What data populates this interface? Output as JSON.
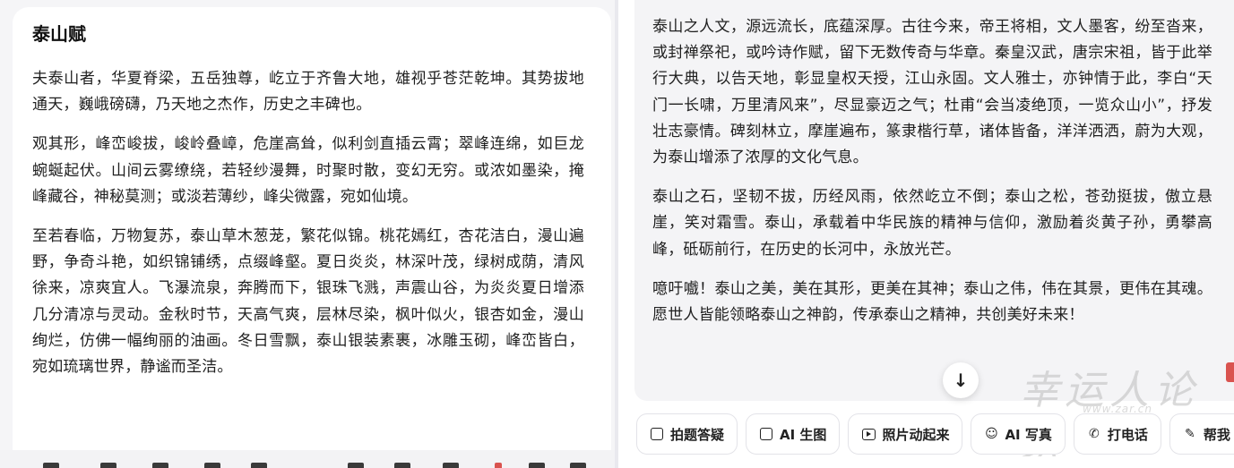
{
  "left": {
    "title": "泰山赋",
    "paragraphs": [
      "夫泰山者，华夏脊梁，五岳独尊，屹立于齐鲁大地，雄视乎苍茫乾坤。其势拔地通天，巍峨磅礴，乃天地之杰作，历史之丰碑也。",
      "观其形，峰峦峻拔，峻岭叠嶂，危崖高耸，似利剑直插云霄；翠峰连绵，如巨龙蜿蜒起伏。山间云雾缭绕，若轻纱漫舞，时聚时散，变幻无穷。或浓如墨染，掩峰藏谷，神秘莫测；或淡若薄纱，峰尖微露，宛如仙境。",
      "至若春临，万物复苏，泰山草木葱茏，繁花似锦。桃花嫣红，杏花洁白，漫山遍野，争奇斗艳，如织锦铺绣，点缀峰壑。夏日炎炎，林深叶茂，绿树成荫，清风徐来，凉爽宜人。飞瀑流泉，奔腾而下，银珠飞溅，声震山谷，为炎炎夏日增添几分清凉与灵动。金秋时节，天高气爽，层林尽染，枫叶似火，银杏如金，漫山绚烂，仿佛一幅绚丽的油画。冬日雪飘，泰山银装素裹，冰雕玉砌，峰峦皆白，宛如琉璃世界，静谧而圣洁。"
    ]
  },
  "right": {
    "paragraphs": [
      "泰山之人文，源远流长，底蕴深厚。古往今来，帝王将相，文人墨客，纷至沓来，或封禅祭祀，或吟诗作赋，留下无数传奇与华章。秦皇汉武，唐宗宋祖，皆于此举行大典，以告天地，彰显皇权天授，江山永固。文人雅士，亦钟情于此，李白“天门一长啸，万里清风来”，尽显豪迈之气；杜甫“会当凌绝顶，一览众山小”，抒发壮志豪情。碑刻林立，摩崖遍布，篆隶楷行草，诸体皆备，洋洋洒洒，蔚为大观，为泰山增添了浓厚的文化气息。",
      "泰山之石，坚韧不拔，历经风雨，依然屹立不倒；泰山之松，苍劲挺拔，傲立悬崖，笑对霜雪。泰山，承载着中华民族的精神与信仰，激励着炎黄子孙，勇攀高峰，砥砺前行，在历史的长河中，永放光芒。",
      "噫吁嚱！泰山之美，美在其形，更美在其神；泰山之伟，伟在其景，更伟在其魂。愿世人皆能领略泰山之神韵，传承泰山之精神，共创美好未来！"
    ],
    "scroll_icon": "↓",
    "watermark": {
      "text": "幸运人论坛",
      "url": "www.zar.cn"
    }
  },
  "actions": [
    {
      "label": "拍题答疑",
      "icon": "photo-question-icon"
    },
    {
      "label": "AI 生图",
      "icon": "image-icon"
    },
    {
      "label": "照片动起来",
      "icon": "play-icon"
    },
    {
      "label": "AI 写真",
      "icon": "portrait-icon"
    },
    {
      "label": "打电话",
      "icon": "phone-icon"
    },
    {
      "label": "帮我",
      "icon": "edit-icon"
    }
  ],
  "colors": {
    "accent": "#222222",
    "panel": "#f4f4f6",
    "seal": "#d9534f"
  }
}
